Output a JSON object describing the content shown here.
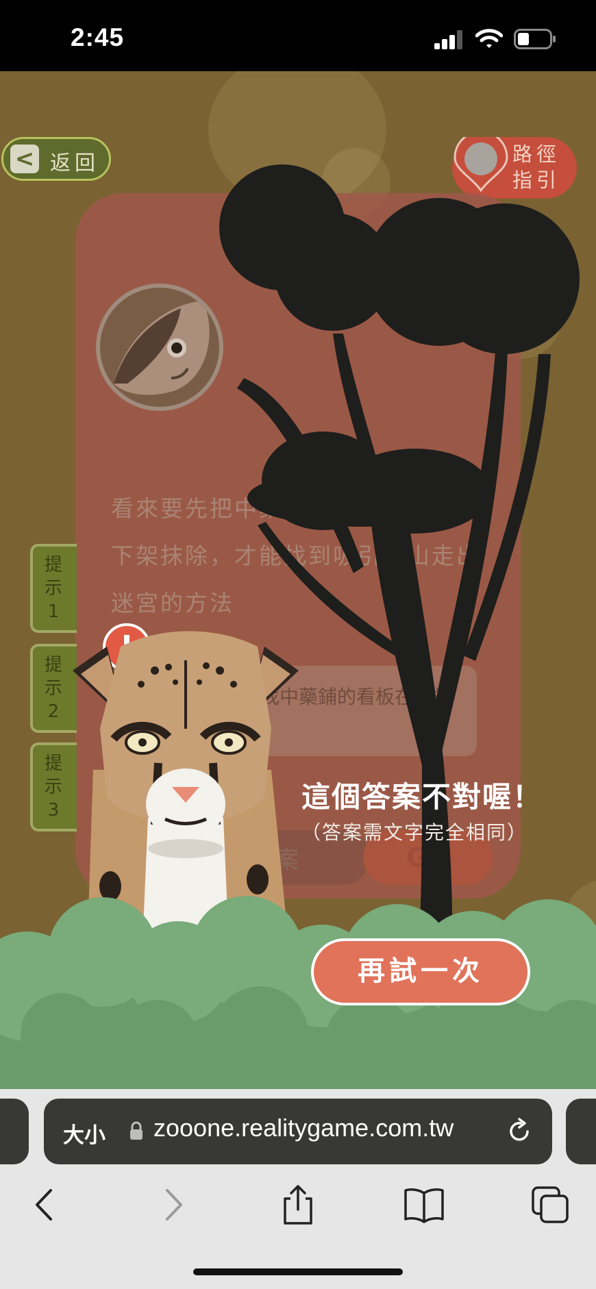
{
  "status_bar": {
    "time": "2:45"
  },
  "game": {
    "back_label": "返回",
    "route_label": "路徑指引",
    "card_text": "看來要先把中藥鋪動物製的中藥材下架抹除，才能找到吸引小山走出迷宮的方法",
    "hint_text": "先去找找中藥鋪的看板在哪裡吧!",
    "hint_tabs": [
      {
        "label": "提示1"
      },
      {
        "label": "提示2"
      },
      {
        "label": "提示3"
      }
    ],
    "answer_placeholder": "輸入答案",
    "go_label": "GO",
    "wrong_message": "這個答案不對喔！",
    "wrong_sub": "（答案需文字完全相同）",
    "retry_label": "再試一次",
    "alert_mark": "!"
  },
  "browser": {
    "size_label": "大小",
    "url": "zooone.realitygame.com.tw"
  }
}
